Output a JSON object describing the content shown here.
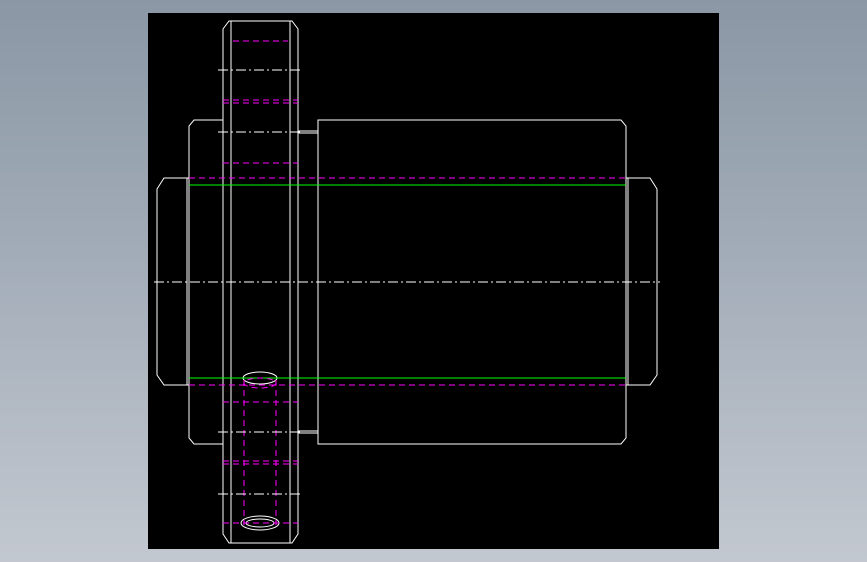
{
  "viewport": {
    "background": "#000000"
  },
  "drawing": {
    "type": "cad-elevation-view",
    "subject": "ball-screw-nut",
    "colors": {
      "outline": "#ffffff",
      "hidden_line": "#ff00ff",
      "center_line": "#ffffff",
      "pitch_line": "#00ff00"
    },
    "line_styles": {
      "hidden_line": "dashed",
      "center_line": "dash-dot"
    }
  }
}
